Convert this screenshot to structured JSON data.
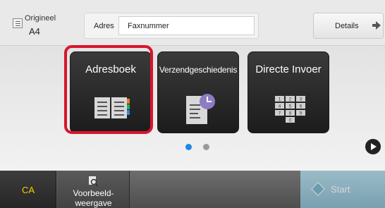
{
  "header": {
    "original_label": "Origineel",
    "original_value": "A4",
    "address_label": "Adres",
    "address_input_value": "Faxnummer",
    "details_label": "Details"
  },
  "tiles": [
    {
      "label": "Adresboek",
      "icon": "address-book-icon",
      "selected": true
    },
    {
      "label": "Verzendgeschiedenis",
      "icon": "send-history-icon",
      "selected": false
    },
    {
      "label": "Directe Invoer",
      "icon": "keypad-icon",
      "selected": false
    }
  ],
  "keypad_keys": [
    "1",
    "2",
    "3",
    "4",
    "5",
    "6",
    "7",
    "8",
    "9",
    "0"
  ],
  "pagination": {
    "pages": 2,
    "current": 1
  },
  "footer": {
    "ca_label": "CA",
    "preview_label": "Voorbeeld-\nweergave",
    "start_label": "Start"
  },
  "colors": {
    "highlight": "#d9142b",
    "ca_text": "#f2d000",
    "dot_active": "#1e88e5",
    "dot_inactive": "#9a9a9a",
    "clock_badge": "#8e7cc3",
    "start_bg": "#a9d5e6"
  }
}
